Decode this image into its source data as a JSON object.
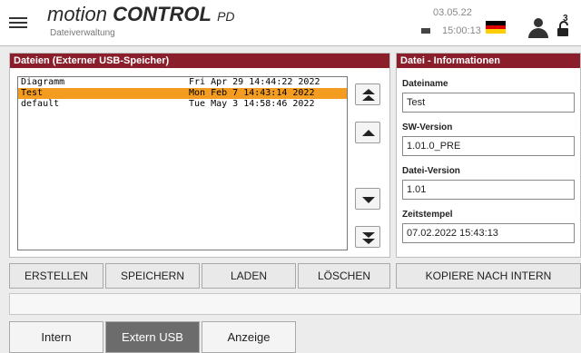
{
  "header": {
    "brand_pre": "motion",
    "brand_main": "CONTROL",
    "brand_post": "PD",
    "subtitle": "Dateiverwaltung",
    "date": "03.05.22",
    "time": "15:00:13",
    "lock_badge": "3",
    "flag_colors": [
      "#000000",
      "#dd0000",
      "#ffce00"
    ]
  },
  "files_panel": {
    "title": "Dateien (Externer USB-Speicher)",
    "files": [
      {
        "name": "Diagramm",
        "timestamp": "Fri Apr 29 14:44:22 2022",
        "selected": false
      },
      {
        "name": "Test",
        "timestamp": "Mon Feb 7 14:43:14 2022",
        "selected": true
      },
      {
        "name": "default",
        "timestamp": "Tue May 3 14:58:46 2022",
        "selected": false
      }
    ]
  },
  "info_panel": {
    "title": "Datei - Informationen",
    "fields": [
      {
        "label": "Dateiname",
        "value": "Test"
      },
      {
        "label": "SW-Version",
        "value": "1.01.0_PRE"
      },
      {
        "label": "Datei-Version",
        "value": "1.01"
      },
      {
        "label": "Zeitstempel",
        "value": "07.02.2022  15:43:13"
      }
    ]
  },
  "actions": {
    "create": "ERSTELLEN",
    "save": "SPEICHERN",
    "load": "LADEN",
    "delete": "LÖSCHEN",
    "copy_internal": "KOPIERE NACH INTERN"
  },
  "tabs": [
    {
      "label": "Intern",
      "active": false
    },
    {
      "label": "Extern USB",
      "active": true
    },
    {
      "label": "Anzeige",
      "active": false
    }
  ],
  "colors": {
    "accent": "#8a1f2b",
    "selection": "#f39c1f"
  }
}
